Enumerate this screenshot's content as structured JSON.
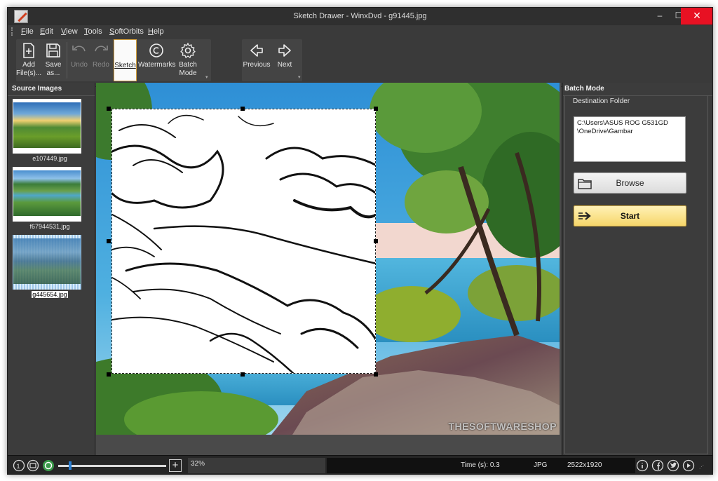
{
  "window": {
    "title": "Sketch Drawer - WinxDvd - g91445.jpg",
    "minimize": "–",
    "maximize": "☐",
    "close": "✕"
  },
  "menu": [
    "File",
    "Edit",
    "View",
    "Tools",
    "SoftOrbits",
    "Help"
  ],
  "toolbar": {
    "add_files": "Add File(s)...",
    "save_as": "Save as...",
    "undo": "Undo",
    "redo": "Redo",
    "sketch": "Sketch",
    "watermarks": "Watermarks",
    "batch_mode": "Batch Mode",
    "previous": "Previous",
    "next": "Next"
  },
  "source_images": {
    "title": "Source Images",
    "items": [
      {
        "name": "e107449.jpg",
        "selected": false
      },
      {
        "name": "f67944531.jpg",
        "selected": false
      },
      {
        "name": "g445654.jpg",
        "selected": true
      }
    ]
  },
  "canvas": {
    "watermark": "THESOFTWARESHOP"
  },
  "batch": {
    "title": "Batch Mode",
    "destination_label": "Destination Folder",
    "destination_value": "C:\\Users\\ASUS ROG G531GD\n\\OneDrive\\Gambar",
    "browse_label": "Browse",
    "start_label": "Start"
  },
  "status": {
    "zoom": "32%",
    "zoom_fraction": 0.1,
    "time": "Time (s): 0.3",
    "format": "JPG",
    "dimensions": "2522x1920"
  },
  "colors": {
    "accent_start": "#f6d66a",
    "close_red": "#e81123",
    "slider": "#2a7fd4"
  }
}
